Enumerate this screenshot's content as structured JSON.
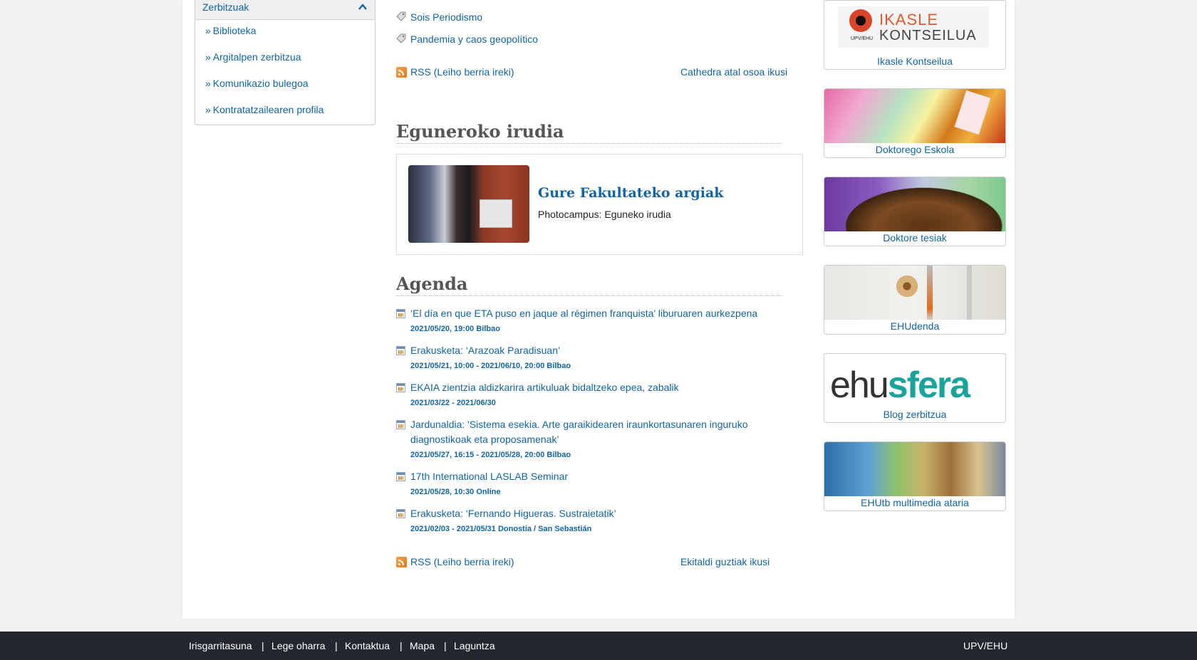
{
  "sidebar": {
    "title": "Zerbitzuak",
    "items": [
      {
        "label": "Biblioteka"
      },
      {
        "label": "Argitalpen zerbitzua"
      },
      {
        "label": "Komunikazio bulegoa"
      },
      {
        "label": "Kontratatzailearen profila"
      }
    ]
  },
  "cathedra": {
    "links": [
      {
        "label": "Sois Periodismo"
      },
      {
        "label": "Pandemia y caos geopolítico"
      }
    ],
    "rss_label": "RSS (Leiho berria ireki)",
    "see_all": "Cathedra atal osoa ikusi"
  },
  "daily_image": {
    "heading": "Eguneroko irudia",
    "title": "Gure Fakultateko argiak",
    "subtitle": "Photocampus: Eguneko irudia"
  },
  "agenda": {
    "heading": "Agenda",
    "events": [
      {
        "title": "‘El día en que ETA puso en jaque al régimen franquista’ liburuaren aurkezpena",
        "date": "2021/05/20, 19:00 Bilbao"
      },
      {
        "title": "Erakusketa: ‘Arazoak Paradisuan’",
        "date": "2021/05/21, 10:00 - 2021/06/10, 20:00 Bilbao"
      },
      {
        "title": "EKAIA zientzia aldizkarira artikuluak bidaltzeko epea, zabalik",
        "date": "2021/03/22 - 2021/06/30"
      },
      {
        "title": "Jardunaldia: 'Sistema esekia. Arte garaikidearen iraunkortasunaren inguruko diagnostikoak eta proposamenak’",
        "date": "2021/05/27, 16:15 - 2021/05/28, 20:00 Bilbao"
      },
      {
        "title": "17th International LASLAB Seminar",
        "date": "2021/05/28, 10:30 Online"
      },
      {
        "title": "Erakusketa: ‘Fernando Higueras. Sustraietatik’",
        "date": "2021/02/03 - 2021/05/31 Donostia / San Sebastián"
      }
    ],
    "rss_label": "RSS (Leiho berria ireki)",
    "see_all": "Ekitaldi guztiak ikusi"
  },
  "right_boxes": [
    {
      "caption": "Ikasle Kontseilua",
      "logo_top": "IKASLE",
      "logo_bottom": "KONTSEILUA",
      "logo_small": "UPV/EHU"
    },
    {
      "caption": "Doktorego Eskola"
    },
    {
      "caption": "Doktore tesiak"
    },
    {
      "caption": "EHUdenda"
    },
    {
      "caption": "Blog zerbitzua",
      "logo_a": "ehu",
      "logo_b": "sfera"
    },
    {
      "caption": "EHUtb multimedia ataria"
    }
  ],
  "footer": {
    "links": [
      {
        "label": "Irisgarritasuna"
      },
      {
        "label": "Lege oharra"
      },
      {
        "label": "Kontaktua"
      },
      {
        "label": "Mapa"
      },
      {
        "label": "Laguntza"
      }
    ],
    "brand": "UPV/EHU"
  },
  "colors": {
    "link": "#1264a3",
    "footer_bg": "#23282f",
    "accent_orange": "#e6761a"
  }
}
